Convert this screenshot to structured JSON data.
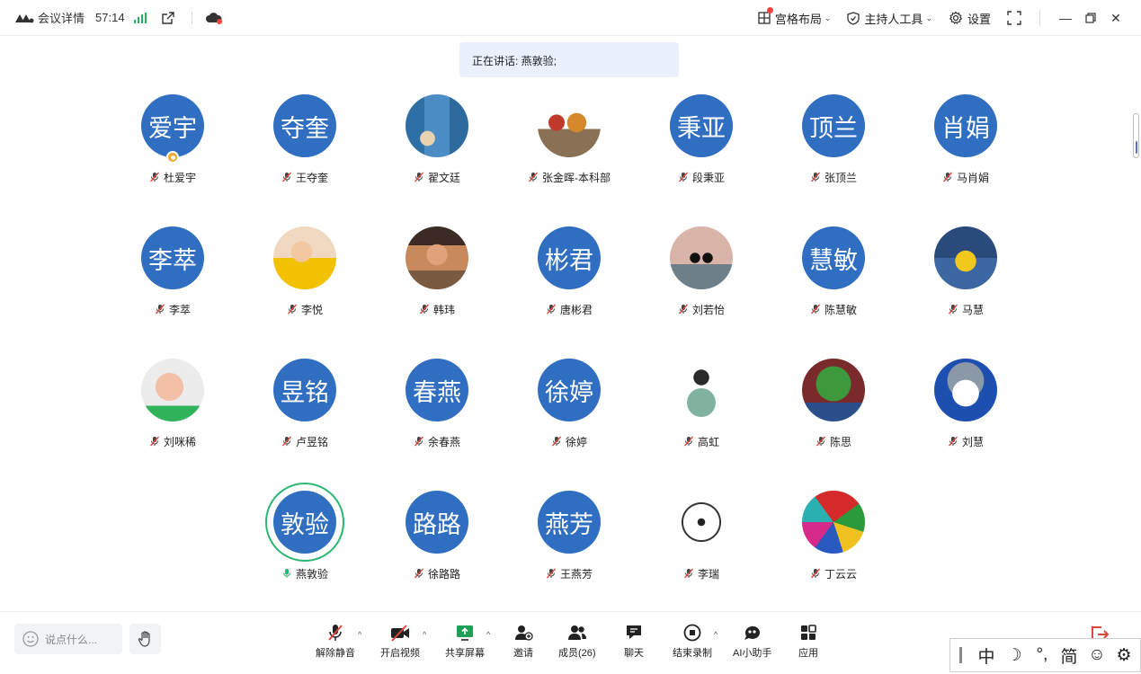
{
  "topbar": {
    "meeting_details": "会议详情",
    "timer": "57:14",
    "grid_layout": "宫格布局",
    "host_tools": "主持人工具",
    "settings": "设置"
  },
  "speaking": "正在讲话: 燕敦验;",
  "participants": [
    {
      "avatar_text": "爱宇",
      "name": "杜爱宇",
      "host": true
    },
    {
      "avatar_text": "夺奎",
      "name": "王夺奎"
    },
    {
      "avatar_text": "",
      "name": "翟文廷",
      "photo": "blue-door"
    },
    {
      "avatar_text": "",
      "name": "张金晖-本科部",
      "photo": "family-bear"
    },
    {
      "avatar_text": "秉亚",
      "name": "段秉亚"
    },
    {
      "avatar_text": "顶兰",
      "name": "张顶兰"
    },
    {
      "avatar_text": "肖娟",
      "name": "马肖娟"
    },
    {
      "avatar_text": "李萃",
      "name": "李萃"
    },
    {
      "avatar_text": "",
      "name": "李悦",
      "photo": "baby-yellow"
    },
    {
      "avatar_text": "",
      "name": "韩玮",
      "photo": "woman-sunset"
    },
    {
      "avatar_text": "彬君",
      "name": "唐彬君"
    },
    {
      "avatar_text": "",
      "name": "刘若怡",
      "photo": "black-swans"
    },
    {
      "avatar_text": "慧敏",
      "name": "陈慧敏"
    },
    {
      "avatar_text": "",
      "name": "马慧",
      "photo": "minion"
    },
    {
      "avatar_text": "",
      "name": "刘咪稀",
      "photo": "laughing-child"
    },
    {
      "avatar_text": "昱铭",
      "name": "卢昱铭"
    },
    {
      "avatar_text": "春燕",
      "name": "余春燕"
    },
    {
      "avatar_text": "徐婷",
      "name": "徐婷"
    },
    {
      "avatar_text": "",
      "name": "高虹",
      "photo": "illustrated-girl"
    },
    {
      "avatar_text": "",
      "name": "陈思",
      "photo": "pepe-frog"
    },
    {
      "avatar_text": "",
      "name": "刘慧",
      "photo": "bugs-bunny"
    },
    {
      "avatar_text": "敦验",
      "name": "燕敦验",
      "speaking": true
    },
    {
      "avatar_text": "路路",
      "name": "徐路路"
    },
    {
      "avatar_text": "燕芳",
      "name": "王燕芳"
    },
    {
      "avatar_text": "",
      "name": "李瑞",
      "photo": "sketch-cat"
    },
    {
      "avatar_text": "",
      "name": "丁云云",
      "photo": "stained-glass"
    }
  ],
  "bottombar": {
    "say_placeholder": "说点什么...",
    "unmute": "解除静音",
    "start_video": "开启视频",
    "share_screen": "共享屏幕",
    "invite": "邀请",
    "members": "成员(26)",
    "chat": "聊天",
    "stop_recording": "结束录制",
    "ai_assistant": "AI小助手",
    "apps": "应用"
  },
  "ime": {
    "mode": "中",
    "punct": "°,",
    "script": "简"
  },
  "colors": {
    "avatar_blue": "#2f6ec1",
    "speaking_ring": "#2bb673",
    "muted_red": "#e0453a",
    "banner_bg": "#eaf1fc"
  }
}
